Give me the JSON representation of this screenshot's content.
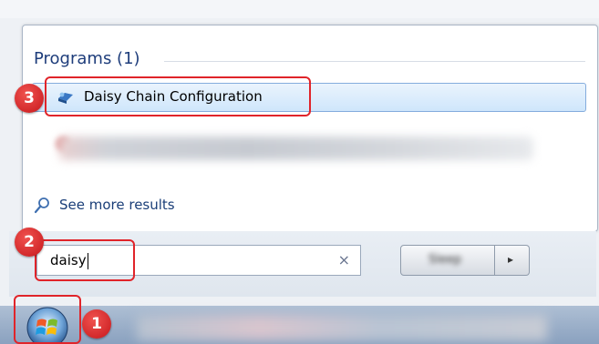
{
  "start_menu": {
    "programs_header": "Programs (1)",
    "program_item": "Daisy Chain Configuration",
    "see_more_results": "See more results",
    "search": {
      "value": "daisy",
      "clear_glyph": "×"
    },
    "shutdown_label": "Sleep",
    "shutdown_arrow_glyph": "▸"
  },
  "annotations": {
    "badge_1": "1",
    "badge_2": "2",
    "badge_3": "3",
    "color": "#e0242a"
  },
  "icons": {
    "program": "program-icon",
    "search": "magnifier-icon",
    "start": "windows-start-orb"
  }
}
